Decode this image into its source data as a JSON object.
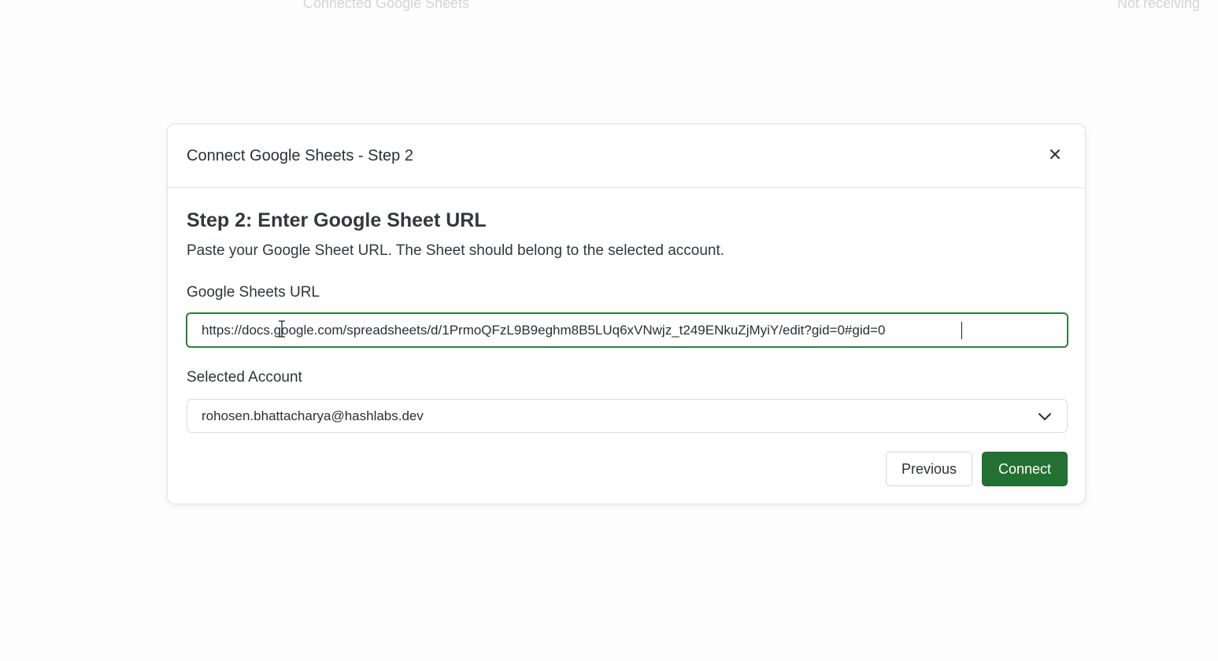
{
  "background": {
    "left_text": "Connected Google Sheets",
    "right_text": "Not receiving"
  },
  "modal": {
    "title": "Connect Google Sheets - Step 2",
    "close_icon": "close-icon",
    "step_heading": "Step 2: Enter Google Sheet URL",
    "step_description": "Paste your Google Sheet URL. The Sheet should belong to the selected account.",
    "url_field": {
      "label": "Google Sheets URL",
      "value": "https://docs.google.com/spreadsheets/d/1PrmoQFzL9B9eghm8B5LUq6xVNwjz_t249ENkuZjMyiY/edit?gid=0#gid=0"
    },
    "account_field": {
      "label": "Selected Account",
      "value": "rohosen.bhattacharya@hashlabs.dev",
      "icon": "chevron-down-icon"
    },
    "buttons": {
      "previous": "Previous",
      "connect": "Connect"
    }
  },
  "colors": {
    "accent": "#237033",
    "input_focus_border": "#2f7d3a",
    "text": "#2b2f36"
  }
}
